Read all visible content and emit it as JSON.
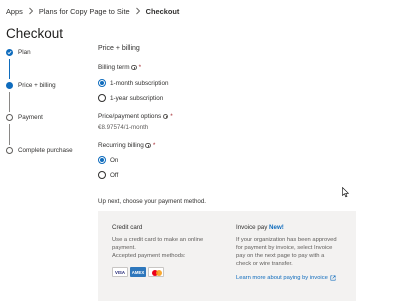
{
  "breadcrumb": {
    "items": [
      "Apps",
      "Plans for Copy Page to Site",
      "Checkout"
    ]
  },
  "page_title": "Checkout",
  "steps": [
    {
      "label": "Plan",
      "state": "done"
    },
    {
      "label": "Price + billing",
      "state": "active"
    },
    {
      "label": "Payment",
      "state": "todo"
    },
    {
      "label": "Complete purchase",
      "state": "todo"
    }
  ],
  "section_heading": "Price + billing",
  "billing_term": {
    "label": "Billing term",
    "required_mark": "*",
    "options": [
      "1-month subscription",
      "1-year subscription"
    ],
    "selected": "1-month subscription"
  },
  "price_options": {
    "label": "Price/payment options",
    "required_mark": "*",
    "value": "€8.97574/1-month"
  },
  "recurring_billing": {
    "label": "Recurring billing",
    "required_mark": "*",
    "options": [
      "On",
      "Off"
    ],
    "selected": "On"
  },
  "payment_intro": "Up next, choose your payment method.",
  "credit_card": {
    "title": "Credit card",
    "line1": "Use a credit card to make an online",
    "line2": "payment.",
    "line3": "Accepted payment methods:",
    "cards": [
      "VISA",
      "AMEX",
      "mastercard"
    ]
  },
  "invoice_pay": {
    "title": "Invoice pay",
    "badge": "New!",
    "line1": "If your organization has been approved",
    "line2": "for payment by invoice, select Invoice",
    "line3": "pay on the next page to pay with a",
    "line4": "check or wire transfer.",
    "link": "Learn more about paying by invoice"
  },
  "colors": {
    "accent": "#0f6cbd",
    "required": "#a4262c",
    "panel": "#f3f2f1"
  }
}
